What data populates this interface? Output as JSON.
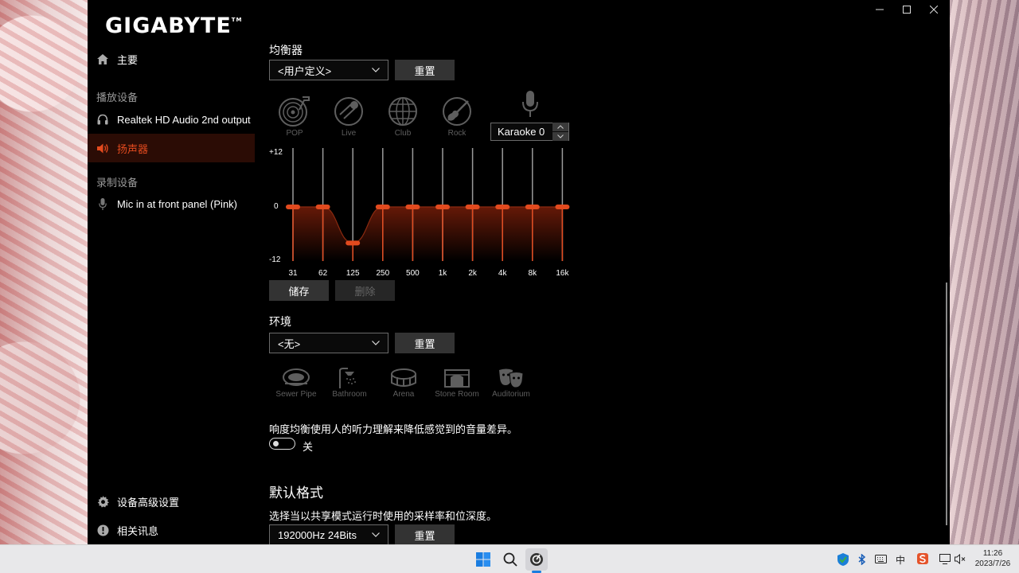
{
  "app": {
    "logo": "GIGABYTE",
    "logo_mark": "TM"
  },
  "sidebar": {
    "home": "主要",
    "playback_header": "播放设备",
    "playback_items": [
      "Realtek HD Audio 2nd output",
      "扬声器"
    ],
    "record_header": "录制设备",
    "record_items": [
      "Mic in at front panel (Pink)"
    ],
    "advanced": "设备高级设置",
    "about": "相关讯息"
  },
  "equalizer": {
    "title": "均衡器",
    "preset_value": "<用户定义>",
    "reset_label": "重置",
    "presets": [
      "POP",
      "Live",
      "Club",
      "Rock"
    ],
    "karaoke_value": "Karaoke 0",
    "y_labels": [
      "+12",
      "0",
      "-12"
    ],
    "bands": [
      "31",
      "62",
      "125",
      "250",
      "500",
      "1k",
      "2k",
      "4k",
      "8k",
      "16k"
    ],
    "gains_db": [
      0,
      0,
      -8,
      0,
      0,
      0,
      0,
      0,
      0,
      0
    ],
    "save_label": "储存",
    "delete_label": "删除"
  },
  "environment": {
    "title": "环境",
    "value": "<无>",
    "reset_label": "重置",
    "presets": [
      "Sewer Pipe",
      "Bathroom",
      "Arena",
      "Stone Room",
      "Auditorium"
    ]
  },
  "loudness": {
    "description": "响度均衡使用人的听力理解来降低感觉到的音量差异。",
    "toggle_label": "关",
    "enabled": false
  },
  "default_format": {
    "title": "默认格式",
    "description": "选择当以共享模式运行时使用的采样率和位深度。",
    "value": "192000Hz 24Bits",
    "reset_label": "重置"
  },
  "taskbar": {
    "ime": "中",
    "time": "11:26",
    "date": "2023/7/26"
  },
  "colors": {
    "accent": "#e24a1e",
    "active_bg": "#2b0c05"
  }
}
